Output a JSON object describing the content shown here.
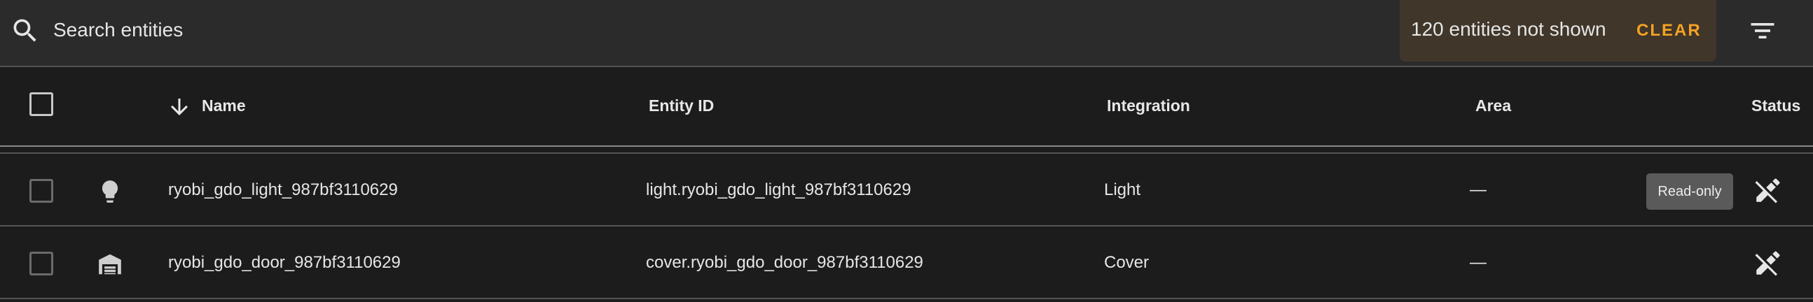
{
  "search": {
    "placeholder": "Search entities",
    "icon": "search-icon"
  },
  "hidden_notice": {
    "text": "120 entities not shown",
    "clear_label": "CLEAR"
  },
  "filter": {
    "icon": "filter-icon"
  },
  "table": {
    "columns": {
      "name": "Name",
      "entity_id": "Entity ID",
      "integration": "Integration",
      "area": "Area",
      "status": "Status"
    },
    "sort": {
      "column": "Name",
      "direction": "descending",
      "icon": "arrow-down-icon"
    },
    "rows": [
      {
        "icon": "lightbulb-icon",
        "name": "ryobi_gdo_light_987bf3110629",
        "entity_id": "light.ryobi_gdo_light_987bf3110629",
        "integration": "Light",
        "area": "—",
        "badge": "Read-only",
        "status_icon": "pencil-off-icon"
      },
      {
        "icon": "garage-icon",
        "name": "ryobi_gdo_door_987bf3110629",
        "entity_id": "cover.ryobi_gdo_door_987bf3110629",
        "integration": "Cover",
        "area": "—",
        "badge": "",
        "status_icon": "pencil-off-icon"
      }
    ]
  },
  "colors": {
    "background": "#1c1c1c",
    "searchbar": "#2b2b2b",
    "notice_bg": "#40362a",
    "accent": "#f5a323",
    "badge_bg": "#5a5a5a"
  }
}
